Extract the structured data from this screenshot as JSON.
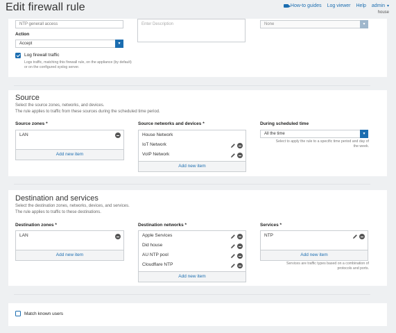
{
  "header": {
    "title": "Edit firewall rule",
    "nav": {
      "howto": "How-to guides",
      "logviewer": "Log viewer",
      "help": "Help",
      "admin": "admin",
      "admin_caret": "▾",
      "user_sub": "house"
    }
  },
  "general": {
    "rule_name_value": "NTP generall access",
    "description_placeholder": "Enter Description",
    "position_value": "None",
    "action_label": "Action",
    "action_value": "Accept",
    "log_label": "Log firewall traffic",
    "log_checked": true,
    "log_help": "Logs traffic, matching this firewall rule, on the appliance (by default) or on the configured syslog server."
  },
  "source": {
    "title": "Source",
    "desc_line1": "Select the source zones, networks, and devices.",
    "desc_line2": "The rule applies to traffic from these sources during the scheduled time period.",
    "zones_label": "Source zones *",
    "zones": [
      "LAN"
    ],
    "zones_add": "Add new item",
    "networks_label": "Source networks and devices *",
    "networks": [
      "House Network",
      "IoT Network",
      "VoIP Network"
    ],
    "networks_add": "Add new item",
    "schedule_label": "During scheduled time",
    "schedule_value": "All the time",
    "schedule_help": "Select to apply the rule to a specific time period and day of the week."
  },
  "destination": {
    "title": "Destination and services",
    "desc_line1": "Select the destination zones, networks, devices, and services.",
    "desc_line2": "The rule applies to traffic to these destinations.",
    "zones_label": "Destination zones *",
    "zones": [
      "LAN"
    ],
    "zones_add": "Add new item",
    "networks_label": "Destination networks *",
    "networks": [
      "Apple Services",
      "Did house",
      "AU NTP pool",
      "Cloudflare NTP"
    ],
    "networks_add": "Add new item",
    "services_label": "Services *",
    "services": [
      "NTP"
    ],
    "services_add": "Add new item",
    "services_help": "Services are traffic types based on a combination of protocols and ports."
  },
  "users": {
    "match_label": "Match known users",
    "match_checked": false
  },
  "colors": {
    "accent": "#1b6db0",
    "background": "#eef0f2",
    "panel": "#ffffff"
  },
  "icons": [
    "video-icon",
    "chevron-down-icon",
    "pencil-icon",
    "minus-circle-icon",
    "checkbox-icon"
  ]
}
